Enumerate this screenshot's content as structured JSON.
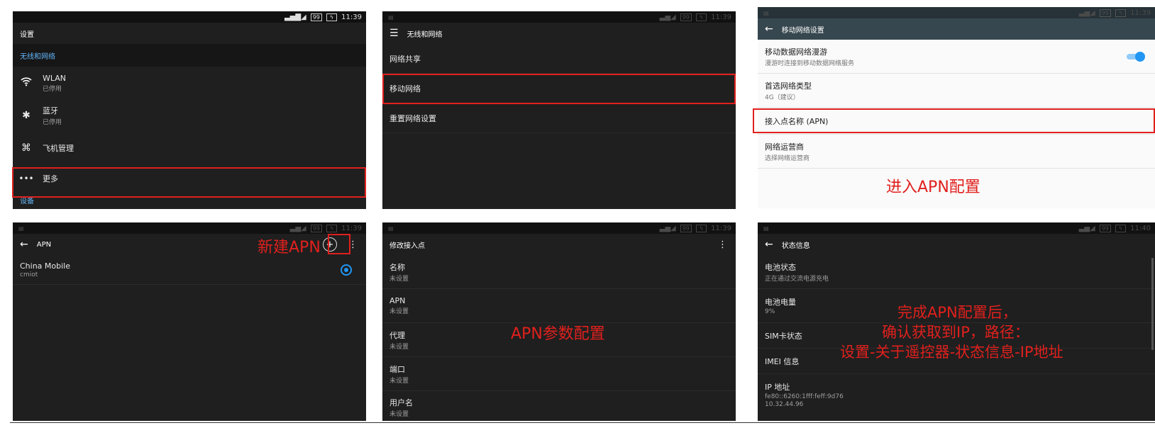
{
  "status_time": "11:39",
  "status_time_alt": "11:40",
  "battery": "99",
  "panel1": {
    "title": "设置",
    "section": "无线和网络",
    "items": [
      {
        "label": "WLAN",
        "sub": "已停用"
      },
      {
        "label": "蓝牙",
        "sub": "已停用"
      },
      {
        "label": "飞机管理"
      },
      {
        "label": "更多"
      }
    ],
    "next_section": "设备"
  },
  "panel2": {
    "title": "无线和网络",
    "items": [
      "网络共享",
      "移动网络",
      "重置网络设置"
    ]
  },
  "panel3": {
    "title": "移动网络设置",
    "items": [
      {
        "label": "移动数据网络漫游",
        "sub": "漫游时连接到移动数据网络服务"
      },
      {
        "label": "首选网络类型",
        "sub": "4G（建议）"
      },
      {
        "label": "接入点名称 (APN)"
      },
      {
        "label": "网络运营商",
        "sub": "选择网络运营商"
      }
    ],
    "annotation": "进入APN配置"
  },
  "panel4": {
    "title": "APN",
    "annotation": "新建APN",
    "apn": {
      "name": "China Mobile",
      "sub": "cmiot"
    }
  },
  "panel5": {
    "title": "修改接入点",
    "fields": [
      {
        "label": "名称",
        "value": "未设置"
      },
      {
        "label": "APN",
        "value": "未设置"
      },
      {
        "label": "代理",
        "value": "未设置"
      },
      {
        "label": "端口",
        "value": "未设置"
      },
      {
        "label": "用户名",
        "value": "未设置"
      }
    ],
    "annotation": "APN参数配置"
  },
  "panel6": {
    "title": "状态信息",
    "items": [
      {
        "label": "电池状态",
        "sub": "正在通过交流电源充电"
      },
      {
        "label": "电池电量",
        "sub": "9%"
      },
      {
        "label": "SIM卡状态"
      },
      {
        "label": "IMEI 信息"
      },
      {
        "label": "IP 地址",
        "sub": "fe80::6260:1fff:feff:9d76",
        "sub2": "10.32.44.96"
      }
    ],
    "annotation_lines": [
      "完成APN配置后，",
      "确认获取到IP，路径：",
      "设置-关于遥控器-状态信息-IP地址"
    ]
  },
  "colors": {
    "accent": "#2196f3",
    "annotation": "#e0201d",
    "dark_bg": "#1f1f1f"
  },
  "icons": [
    "wifi-icon",
    "bluetooth-icon",
    "airplane-icon",
    "more-icon",
    "menu-icon",
    "back-arrow-icon",
    "add-circle-icon",
    "overflow-menu-icon",
    "radio-selected-icon",
    "toggle-on-icon"
  ]
}
